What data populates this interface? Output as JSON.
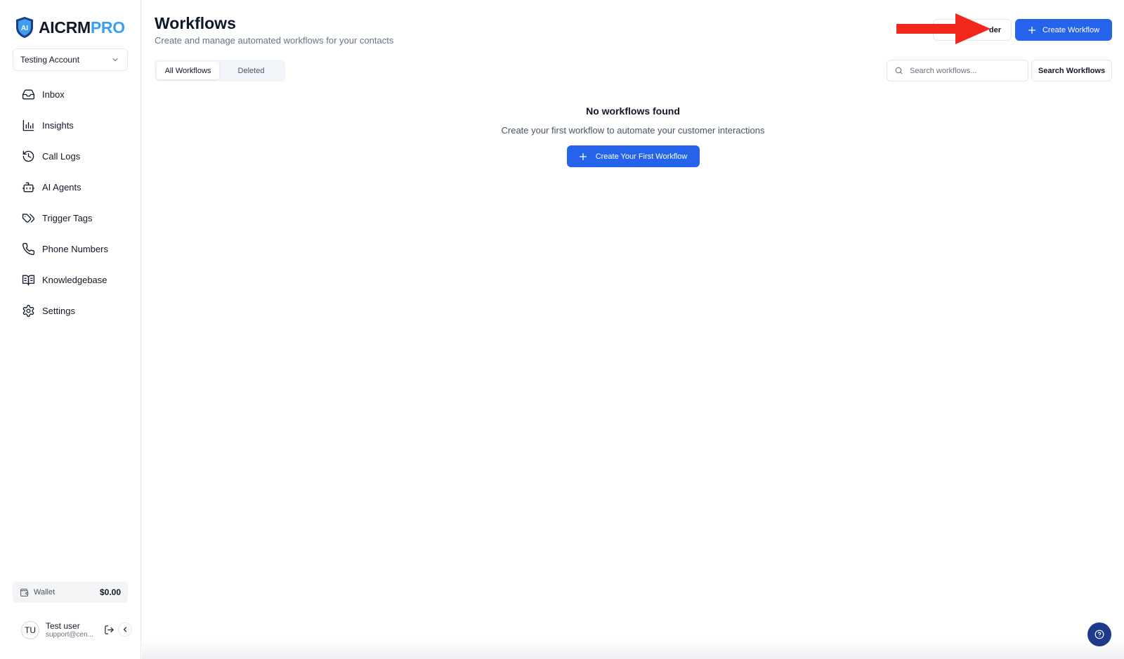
{
  "brand": {
    "name_part1": "AICRM",
    "name_part2": "PRO",
    "logo_icon": "shield-logo"
  },
  "account": {
    "selected": "Testing Account",
    "icon": "chevron-down-icon"
  },
  "sidebar": {
    "items": [
      {
        "label": "Inbox",
        "icon": "inbox-icon"
      },
      {
        "label": "Insights",
        "icon": "bar-chart-icon"
      },
      {
        "label": "Call Logs",
        "icon": "history-icon"
      },
      {
        "label": "AI Agents",
        "icon": "bot-icon"
      },
      {
        "label": "Trigger Tags",
        "icon": "tags-icon"
      },
      {
        "label": "Phone Numbers",
        "icon": "phone-icon"
      },
      {
        "label": "Knowledgebase",
        "icon": "book-icon"
      },
      {
        "label": "Settings",
        "icon": "gear-icon"
      }
    ]
  },
  "wallet": {
    "label": "Wallet",
    "amount": "$0.00"
  },
  "user": {
    "initials": "TU",
    "name": "Test user",
    "email": "support@cen..."
  },
  "header": {
    "title": "Workflows",
    "subtitle": "Create and manage automated workflows for your contacts",
    "partial_button_label": "der",
    "create_button_label": "Create Workflow"
  },
  "tabs": [
    {
      "label": "All Workflows",
      "active": true
    },
    {
      "label": "Deleted",
      "active": false
    }
  ],
  "search": {
    "placeholder": "Search workflows...",
    "value": "",
    "button_label": "Search Workflows"
  },
  "empty_state": {
    "title": "No workflows found",
    "text": "Create your first workflow to automate your customer interactions",
    "button_label": "Create Your First Workflow"
  },
  "colors": {
    "primary": "#2563eb",
    "brand_accent": "#3b9ef0",
    "annotation_arrow": "#f0271a",
    "help_button": "#1e3a8a"
  }
}
